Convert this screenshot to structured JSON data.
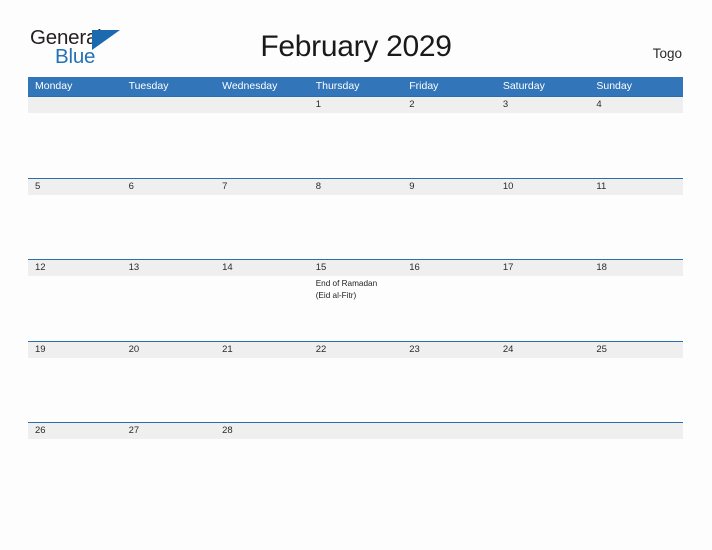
{
  "logo": {
    "word_one": "General",
    "word_two": "Blue",
    "triangle_icon": "triangle-icon",
    "brand_blue": "#2472b5"
  },
  "header": {
    "title": "February 2029",
    "country": "Togo"
  },
  "theme": {
    "header_blue": "#3275b8",
    "row_rule_blue": "#2a6ead",
    "date_strip_grey": "#efefef",
    "page_background": "#fdfdfd"
  },
  "calendar": {
    "weekday_headers": [
      "Monday",
      "Tuesday",
      "Wednesday",
      "Thursday",
      "Friday",
      "Saturday",
      "Sunday"
    ],
    "weeks": [
      {
        "days": [
          {
            "date": "",
            "events": []
          },
          {
            "date": "",
            "events": []
          },
          {
            "date": "",
            "events": []
          },
          {
            "date": "1",
            "events": []
          },
          {
            "date": "2",
            "events": []
          },
          {
            "date": "3",
            "events": []
          },
          {
            "date": "4",
            "events": []
          }
        ]
      },
      {
        "days": [
          {
            "date": "5",
            "events": []
          },
          {
            "date": "6",
            "events": []
          },
          {
            "date": "7",
            "events": []
          },
          {
            "date": "8",
            "events": []
          },
          {
            "date": "9",
            "events": []
          },
          {
            "date": "10",
            "events": []
          },
          {
            "date": "11",
            "events": []
          }
        ]
      },
      {
        "days": [
          {
            "date": "12",
            "events": []
          },
          {
            "date": "13",
            "events": []
          },
          {
            "date": "14",
            "events": []
          },
          {
            "date": "15",
            "events": [
              "End of Ramadan",
              "(Eid al-Fitr)"
            ]
          },
          {
            "date": "16",
            "events": []
          },
          {
            "date": "17",
            "events": []
          },
          {
            "date": "18",
            "events": []
          }
        ]
      },
      {
        "days": [
          {
            "date": "19",
            "events": []
          },
          {
            "date": "20",
            "events": []
          },
          {
            "date": "21",
            "events": []
          },
          {
            "date": "22",
            "events": []
          },
          {
            "date": "23",
            "events": []
          },
          {
            "date": "24",
            "events": []
          },
          {
            "date": "25",
            "events": []
          }
        ]
      },
      {
        "days": [
          {
            "date": "26",
            "events": []
          },
          {
            "date": "27",
            "events": []
          },
          {
            "date": "28",
            "events": []
          },
          {
            "date": "",
            "events": []
          },
          {
            "date": "",
            "events": []
          },
          {
            "date": "",
            "events": []
          },
          {
            "date": "",
            "events": []
          }
        ]
      }
    ]
  }
}
